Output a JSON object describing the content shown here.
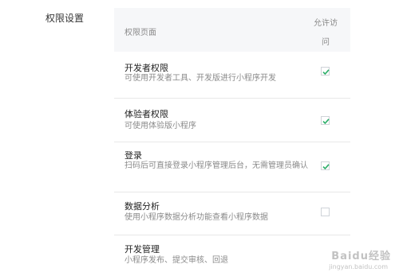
{
  "section": {
    "label": "权限设置"
  },
  "header": {
    "page_col": "权限页面",
    "allow_col": "允许访问"
  },
  "rows": [
    {
      "title": "开发者权限",
      "desc": "可使用开发者工具、开发版进行小程序开发",
      "checked": true
    },
    {
      "title": "体验者权限",
      "desc": "可使用体验版小程序",
      "checked": true
    },
    {
      "title": "登录",
      "desc": "扫码后可直接登录小程序管理后台，无需管理员确认",
      "checked": true
    },
    {
      "title": "数据分析",
      "desc": "使用小程序数据分析功能查看小程序数据",
      "checked": false
    },
    {
      "title": "开发管理",
      "desc": "小程序发布、提交审核、回退",
      "checked": false
    }
  ],
  "watermark": {
    "text": "Baidu经验",
    "sub": "jingyan.baidu.com"
  },
  "colors": {
    "check": "#2aae67"
  }
}
